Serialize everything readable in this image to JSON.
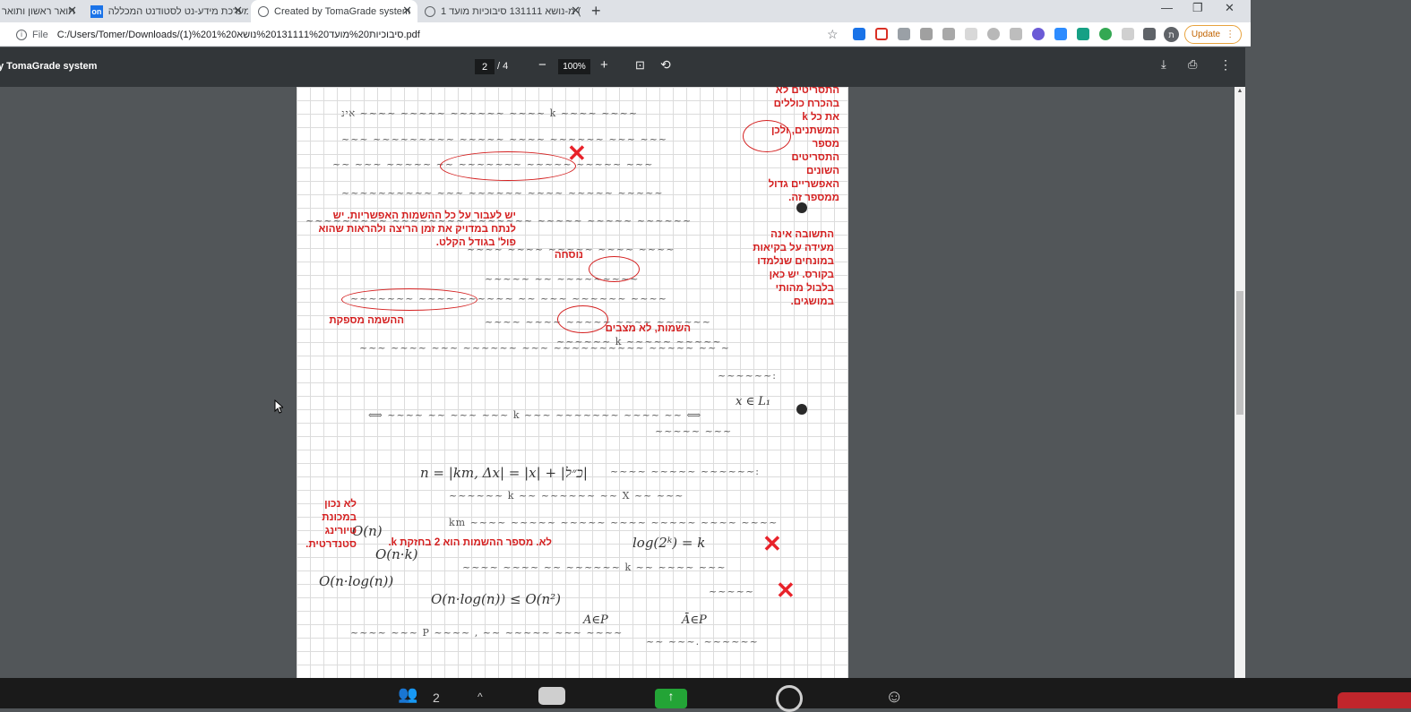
{
  "browser": {
    "tabs": [
      {
        "label": "תואר ראשון ותואר",
        "active": false
      },
      {
        "label": "מערכת מידע-נט לסטודנט המכללה",
        "active": false,
        "favicon": "on"
      },
      {
        "label": "Created by TomaGrade system",
        "active": true
      },
      {
        "label": "מ-נושא 131111 סיבוכיות מועד 1 (",
        "active": false
      }
    ],
    "new_tab": "+",
    "window_controls": {
      "minimize": "—",
      "restore": "❐",
      "close": "✕"
    },
    "address": {
      "scheme_label": "File",
      "url": "C:/Users/Tomer/Downloads/(1)%201%20סיבוכיות%20מועד%20131111%20נושא.pdf"
    },
    "profile_initial": "ת",
    "update_label": "Update"
  },
  "pdf_toolbar": {
    "title": "y TomaGrade system",
    "current_page": "2",
    "page_separator": "/ 4",
    "zoom": "100%",
    "zoom_out": "−",
    "zoom_in": "+"
  },
  "annotations": {
    "right_note_1": "התסריטים לא בהכרח כוללים את כל k המשתנים, ולכן מספר התסריטים השונים האפשריים גדול ממספר זה.",
    "right_note_2": "התשובה אינה מעידה על בקיאות במונחים שנלמדו בקורס. יש כאן בלבול מהותי במושגים.",
    "center_note_1": "יש לעבור על כל ההשמות האפשריות. יש לנתח במדויק את זמן הריצה ולהראות שהוא פול' בגודל הקלט.",
    "nusha": "נוסחה",
    "hashama_maspeket": "ההשמה מספקת",
    "hashamot": "השמות, לא מצבים",
    "left_note": "לא נכון במכונת טיורינג סטנדרטית.",
    "mispar_hashamot": "לא. מספר ההשמות הוא 2 בחזקת k."
  },
  "math": {
    "line_n": "n = |km, Δx| = |x| + |כ״ל|",
    "O_nk": "O(n·k)",
    "O_nlogn": "O(n·log(n))",
    "O_ineq": "O(n·log(n)) ≤ O(n²)",
    "log_expr": "log(2ᵏ) = k",
    "O_n": "O(n)",
    "A_eP": "A∈P",
    "Abar_eP": "Ā∈P",
    "x_in_L": "x ∈ L₁"
  },
  "bottom_bar": {
    "participants_count": "2"
  }
}
